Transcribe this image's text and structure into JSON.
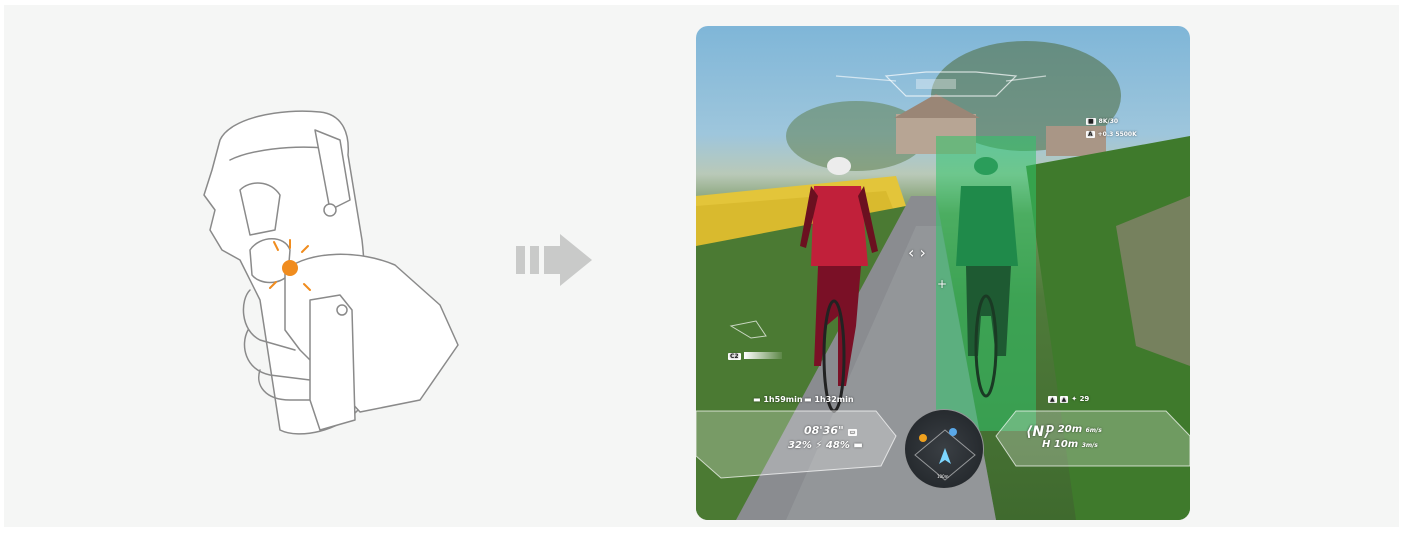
{
  "hud": {
    "status_rec": "8K/30",
    "status_exp": "+0.3  5500K",
    "channel": "C2",
    "timer_left": "1h59min",
    "timer_right": "1h32min",
    "split_time": "08'36\"",
    "battery": "32%",
    "battery2": "48%",
    "nav_d_label": "D",
    "nav_d_value": "20m",
    "nav_d_unit": "6m/s",
    "nav_h_label": "H",
    "nav_h_value": "10m",
    "nav_h_unit": "3m/s",
    "compass": "N",
    "signal_count": "29",
    "map_scale": "100m"
  },
  "colors": {
    "background": "#f5f6f5",
    "accent_orange": "#f08c1e",
    "tracked_red": "#c1203a",
    "tracked_green": "#2fc46a",
    "arrow_gray": "#c9cac9"
  },
  "icons": [
    "hand-grip-illustration",
    "arrow-right-icon",
    "camera-icon",
    "compass-icon",
    "signal-icon",
    "battery-icon",
    "crosshair-icon"
  ]
}
